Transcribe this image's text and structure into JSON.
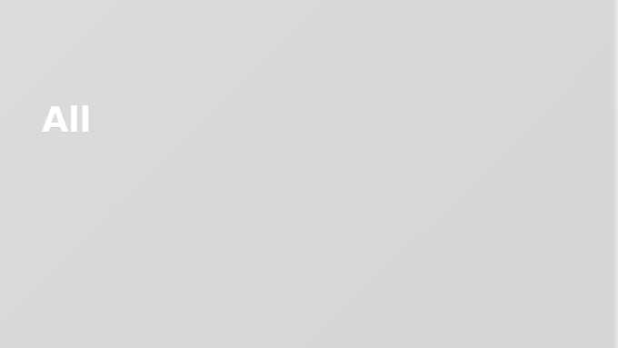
{
  "slide": {
    "headline": "All",
    "background_color": "#d8d8d8",
    "text_color": "#ffffff"
  }
}
